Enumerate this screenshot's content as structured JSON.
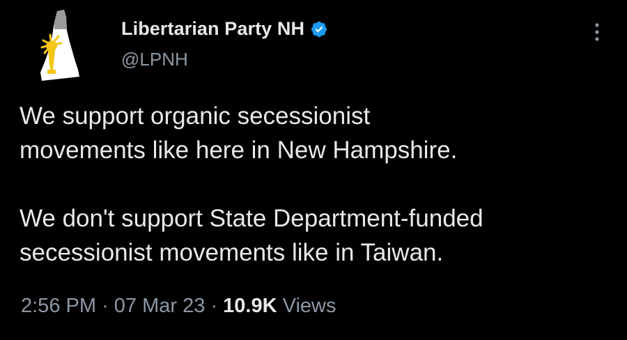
{
  "author": {
    "display_name": "Libertarian Party NH",
    "handle": "@LPNH",
    "verified": true,
    "avatar_icon": "new-hampshire-torch-logo-icon",
    "verified_icon": "verified-badge-icon",
    "verified_color": "#1d9bf0"
  },
  "menu": {
    "icon": "more-vertical-icon"
  },
  "tweet": {
    "paragraph_1_line_1": "We support organic secessionist",
    "paragraph_1_line_2": "movements like here in New Hampshire.",
    "paragraph_2_line_1": "We don't support State Department-funded",
    "paragraph_2_line_2": "secessionist movements like in Taiwan."
  },
  "meta": {
    "time": "2:56 PM",
    "separator": "·",
    "date": "07 Mar 23",
    "views_count": "10.9K",
    "views_label": "Views"
  },
  "colors": {
    "background": "#000000",
    "primary_text": "#e7e9ea",
    "secondary_text": "#8b98a5",
    "logo_gold": "#f5c518"
  }
}
